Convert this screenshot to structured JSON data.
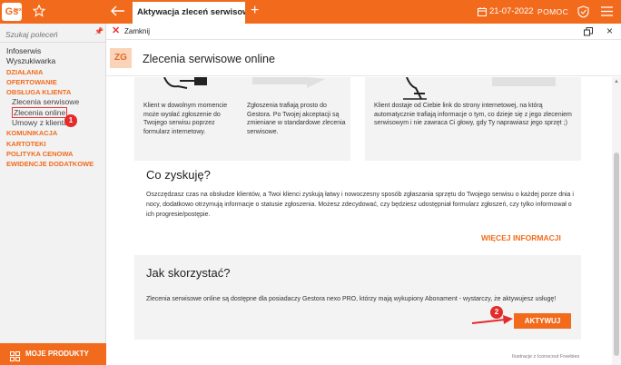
{
  "app": {
    "logo": "Gs",
    "logo_sup": "nexo",
    "tab_title": "Aktywacja zleceń serwisowy",
    "date": "21-07-2022",
    "help": "POMOC"
  },
  "sidebar": {
    "search_placeholder": "Szukaj poleceń",
    "items": [
      {
        "label": "Infoserwis",
        "kind": "plain"
      },
      {
        "label": "Wyszukiwarka",
        "kind": "plain"
      },
      {
        "label": "DZIAŁANIA",
        "kind": "cat"
      },
      {
        "label": "OFERTOWANIE",
        "kind": "cat"
      },
      {
        "label": "OBSŁUGA KLIENTA",
        "kind": "cat"
      },
      {
        "label": "Zlecenia serwisowe",
        "kind": "sub"
      },
      {
        "label": "Zlecenia online",
        "kind": "sub-selected"
      },
      {
        "label": "Umowy z klientami",
        "kind": "sub"
      },
      {
        "label": "KOMUNIKACJA",
        "kind": "cat"
      },
      {
        "label": "KARTOTEKI",
        "kind": "cat"
      },
      {
        "label": "POLITYKA CENOWA",
        "kind": "cat"
      },
      {
        "label": "EWIDENCJE DODATKOWE",
        "kind": "cat"
      }
    ],
    "badge1": "1",
    "products": "MOJE PRODUKTY"
  },
  "closebar": {
    "label": "Zamknij"
  },
  "header": {
    "badge": "ZG",
    "title": "Zlecenia serwisowe online"
  },
  "cards": {
    "c1_text": "Klient w dowolnym momencie może wysłać zgłoszenie do Twojego serwisu poprzez formularz internetowy.",
    "c2_text": "Zgłoszenia trafiają prosto do Gestora. Po Twojej akceptacji są zmieniane w standardowe zlecenia serwisowe.",
    "c3_text": "Klient dostaje od Ciebie link do strony internetowej, na którą automatycznie trafiają informacje o tym, co dzieje się z jego zleceniem serwisowym i nie zawraca Ci głowy, gdy Ty naprawiasz jego sprzęt ;)"
  },
  "gain": {
    "title": "Co zyskuję?",
    "text": "Oszczędzasz czas na obsłudze klientów, a Twoi klienci zyskują łatwy i nowoczesny sposób zgłaszania sprzętu do Twojego serwisu o każdej porze dnia i nocy, dodatkowo otrzymują informacje o statusie zgłoszenia. Możesz zdecydować, czy będziesz udostępniał formularz zgłoszeń, czy tylko informował o ich progresie/postępie.",
    "more": "WIĘCEJ INFORMACJI"
  },
  "howto": {
    "title": "Jak skorzystać?",
    "text": "Zlecenia serwisowe online są dostępne dla posiadaczy Gestora nexo PRO, którzy mają wykupiony Abonament - wystarczy, że aktywujesz usługę!",
    "button": "AKTYWUJ",
    "badge2": "2"
  },
  "footer": {
    "credit": "Ilustracje z Iconscout Freebies"
  },
  "colors": {
    "accent": "#f26b1d",
    "annotation": "#e32b2b",
    "panel": "#f3f3f3"
  }
}
